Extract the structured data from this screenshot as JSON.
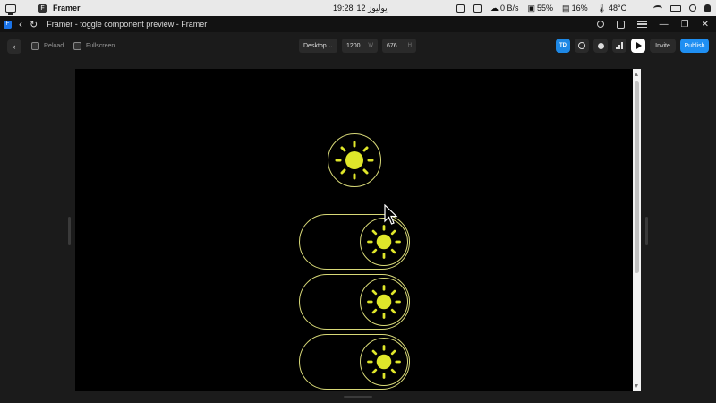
{
  "os_bar": {
    "app_name": "Framer",
    "time": "19:28",
    "date": "12 يوليوز",
    "network_speed": "0 B/s",
    "cpu": "55%",
    "memory": "16%",
    "temperature": "48°C"
  },
  "window": {
    "title": "Framer - toggle component preview - Framer"
  },
  "toolbar": {
    "reload_label": "Reload",
    "fullscreen_label": "Fullscreen",
    "device_select": "Desktop",
    "width_value": "1200",
    "width_unit": "W",
    "height_value": "676",
    "height_unit": "H",
    "avatar_initials": "TD",
    "invite_label": "Invite",
    "publish_label": "Publish"
  },
  "colors": {
    "sun": "#dfe62a",
    "outline": "#d8d978",
    "publish": "#1f8ff2",
    "avatar": "#1e88e5"
  },
  "preview": {
    "icons": [
      "sun-icon",
      "sun-icon",
      "sun-icon",
      "sun-icon"
    ]
  }
}
